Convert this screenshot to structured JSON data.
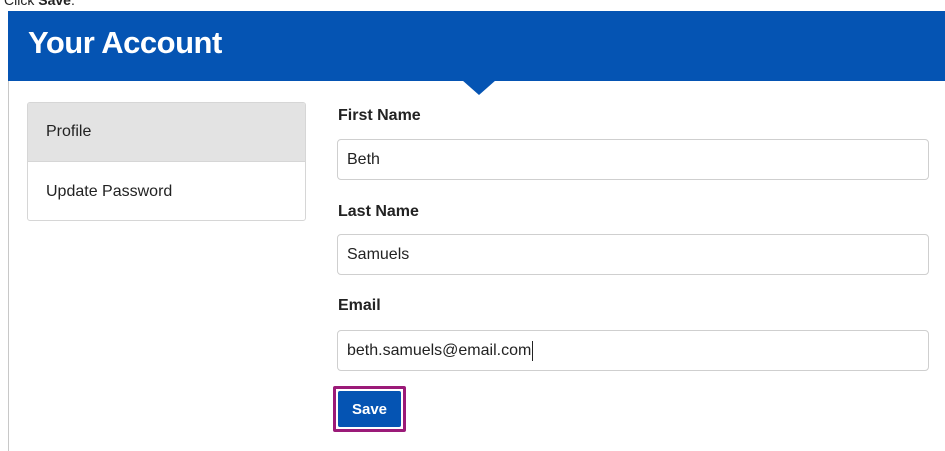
{
  "instruction": {
    "prefix": "Click ",
    "target": "Save",
    "suffix": "."
  },
  "header": {
    "title": "Your Account"
  },
  "sidebar": {
    "items": [
      {
        "label": "Profile",
        "active": true
      },
      {
        "label": "Update Password",
        "active": false
      }
    ]
  },
  "form": {
    "first_name": {
      "label": "First Name",
      "value": "Beth"
    },
    "last_name": {
      "label": "Last Name",
      "value": "Samuels"
    },
    "email": {
      "label": "Email",
      "value": "beth.samuels@email.com"
    },
    "save_label": "Save"
  },
  "colors": {
    "header_blue": "#0554b3",
    "highlight": "#9b1a78",
    "sidebar_active": "#e3e3e3"
  }
}
